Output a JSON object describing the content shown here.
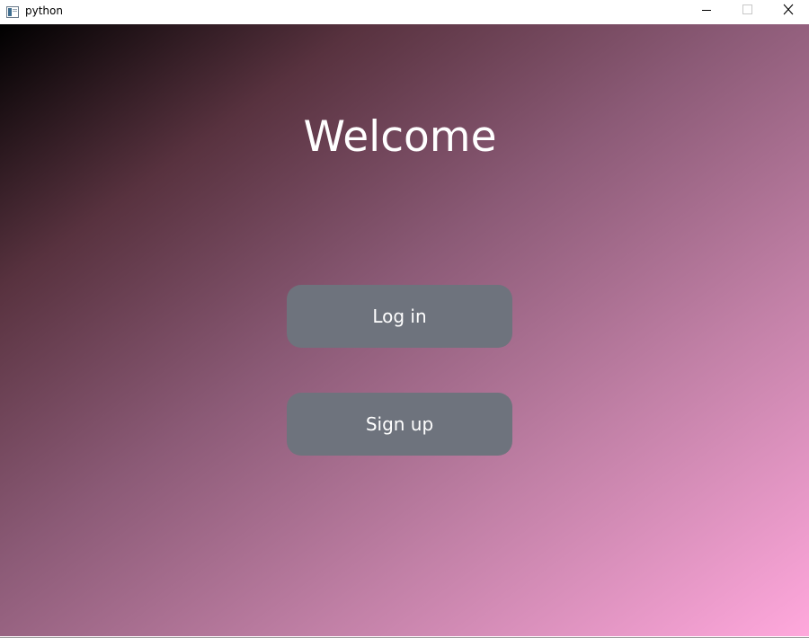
{
  "window": {
    "title": "python",
    "app_icon": "python-window-icon",
    "controls": {
      "minimize_icon": "minimize-icon",
      "maximize_icon": "maximize-icon",
      "close_icon": "close-icon"
    }
  },
  "main": {
    "heading": "Welcome",
    "login_label": "Log in",
    "signup_label": "Sign up"
  },
  "colors": {
    "gradient_start": "#000000",
    "gradient_end": "#ffa8dc",
    "button_bg": "#6e737d",
    "text": "#ffffff"
  }
}
